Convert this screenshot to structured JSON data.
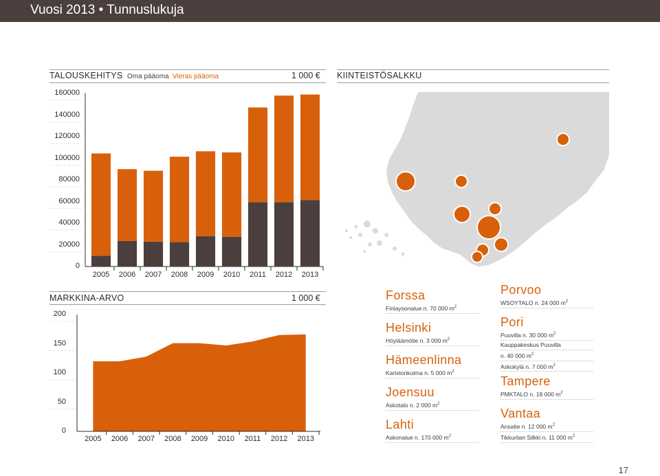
{
  "header": {
    "title": "Vuosi 2013 • Tunnuslukuja"
  },
  "colors": {
    "orange": "#d9600b",
    "dark": "#4a3f3d",
    "map_land": "#dadada"
  },
  "finance": {
    "title": "TALOUSKEHITYS",
    "legend": {
      "equity": "Oma pääoma",
      "debt": "Vieras pääoma"
    },
    "unit": "1 000 €"
  },
  "market": {
    "title": "MARKKINA-ARVO",
    "unit": "1 000 €"
  },
  "portfolio": {
    "title": "KIINTEISTÖSALKKU"
  },
  "chart_data": [
    {
      "type": "bar",
      "stacked": true,
      "categories": [
        "2005",
        "2006",
        "2007",
        "2008",
        "2009",
        "2010",
        "2011",
        "2012",
        "2013"
      ],
      "series": [
        {
          "name": "Oma pääoma",
          "color": "#4a3f3d",
          "values": [
            10000,
            23500,
            23000,
            22500,
            28000,
            27500,
            59500,
            59500,
            61500
          ]
        },
        {
          "name": "Vieras pääoma",
          "color": "#d9600b",
          "values": [
            94500,
            66500,
            65500,
            79000,
            78500,
            78000,
            87500,
            98500,
            97500
          ]
        }
      ],
      "ylim": [
        0,
        160000
      ],
      "yticks": [
        "0",
        "20000",
        "40000",
        "60000",
        "80000",
        "100000",
        "120000",
        "140000",
        "160000"
      ],
      "grid": false
    },
    {
      "type": "area",
      "x": [
        "2005",
        "2006",
        "2007",
        "2008",
        "2009",
        "2010",
        "2011",
        "2012",
        "2013"
      ],
      "series": [
        {
          "values": [
            120,
            120,
            128,
            151,
            151,
            147,
            154,
            165,
            166
          ]
        }
      ],
      "ylim": [
        0,
        200
      ],
      "yticks": [
        "0",
        "50",
        "100",
        "150",
        "200"
      ],
      "color": "#d9600b"
    }
  ],
  "locations": {
    "left": [
      {
        "name": "Forssa",
        "lines": [
          [
            "Finlaysonalue n. 70 000 m",
            "2"
          ]
        ]
      },
      {
        "name": "Helsinki",
        "lines": [
          [
            "Höyläämötie n. 3 000 m",
            "2"
          ]
        ]
      },
      {
        "name": "Hämeenlinna",
        "lines": [
          [
            "Karistonkulma n. 5 000 m",
            "2"
          ]
        ]
      },
      {
        "name": "Joensuu",
        "lines": [
          [
            "Askotalo n. 2 000 m",
            "2"
          ]
        ]
      },
      {
        "name": "Lahti",
        "lines": [
          [
            "Askonalue n. 170 000 m",
            "2"
          ]
        ]
      }
    ],
    "right": [
      {
        "name": "Porvoo",
        "lines": [
          [
            "WSOYTALO n. 24 000 m",
            "2"
          ]
        ]
      },
      {
        "name": "Pori",
        "lines": [
          [
            "Puuvilla n. 30 000 m",
            "2"
          ],
          [
            "Kauppakeskus Puuvilla",
            ""
          ],
          [
            "n. 40 000 m",
            "2"
          ],
          [
            "Askokylä n. 7 000 m",
            "2"
          ]
        ]
      },
      {
        "name": "Tampere",
        "lines": [
          [
            "PMKTALO n. 18 000 m",
            "2"
          ]
        ]
      },
      {
        "name": "Vantaa",
        "lines": [
          [
            "Ansatie n. 12 000 m",
            "2"
          ],
          [
            "Tikkurilan Silkki n. 11 000 m",
            "2"
          ]
        ]
      }
    ]
  },
  "map_markers": [
    {
      "name": "pori-marker",
      "size": "large"
    },
    {
      "name": "tampere-marker",
      "size": "small"
    },
    {
      "name": "joensuu-marker",
      "size": "small"
    },
    {
      "name": "hameenlinna-marker",
      "size": "small"
    },
    {
      "name": "lahti-marker",
      "size": "medium"
    },
    {
      "name": "lahti-large-marker",
      "size": "large"
    },
    {
      "name": "porvoo-marker",
      "size": "small"
    },
    {
      "name": "vantaa-marker",
      "size": "small"
    },
    {
      "name": "helsinki-marker",
      "size": "small"
    },
    {
      "name": "forssa-marker",
      "size": "small"
    }
  ],
  "page_number": "17"
}
